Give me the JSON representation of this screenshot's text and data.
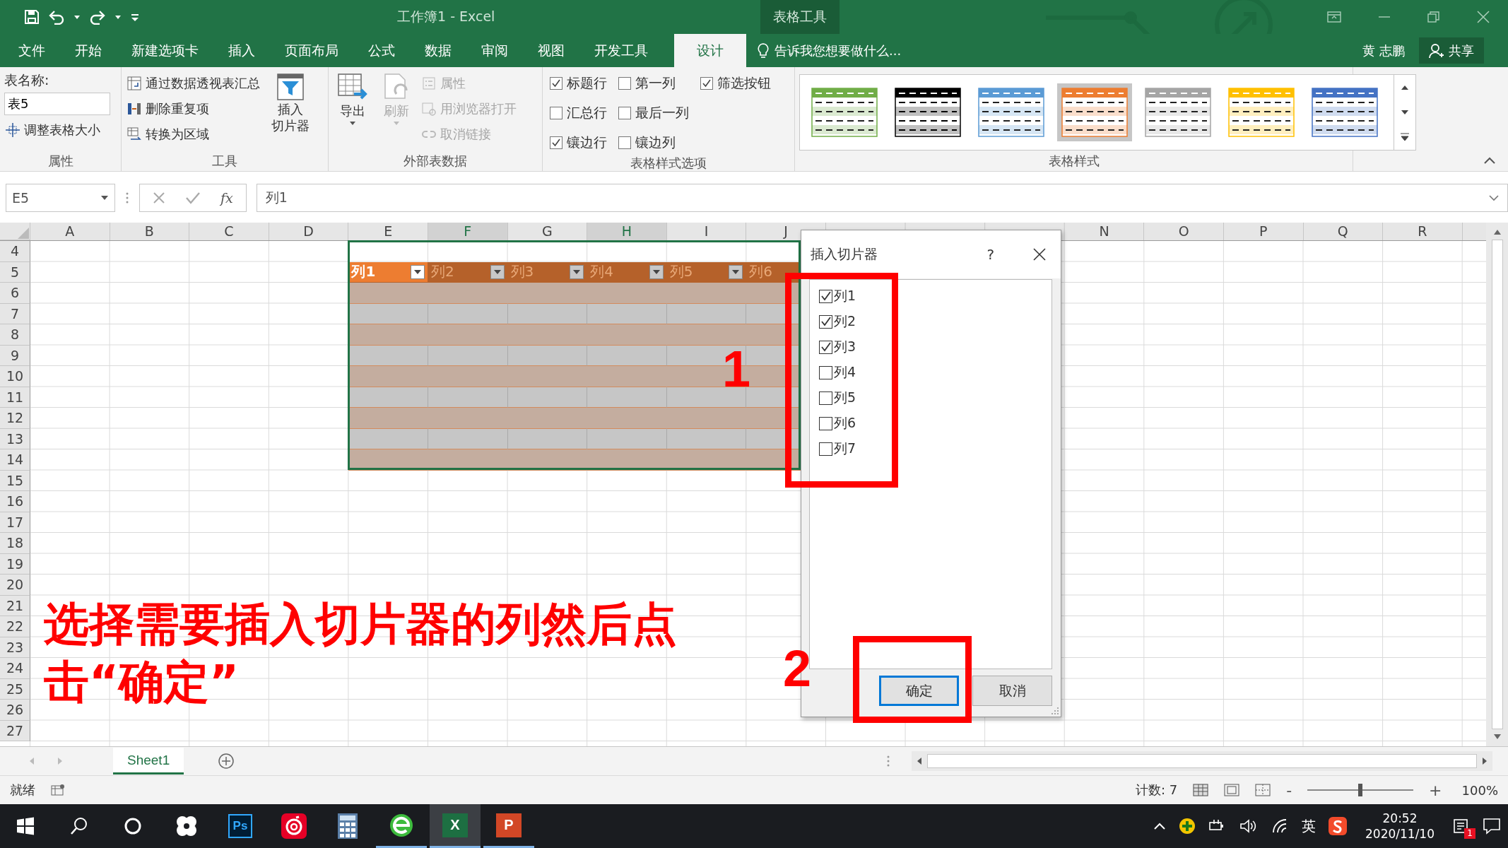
{
  "title_bar": {
    "title": "工作簿1 - Excel",
    "context_label": "表格工具"
  },
  "ribbon_tabs": [
    {
      "label": "文件",
      "selected": false
    },
    {
      "label": "开始",
      "selected": false
    },
    {
      "label": "新建选项卡",
      "selected": false
    },
    {
      "label": "插入",
      "selected": false
    },
    {
      "label": "页面布局",
      "selected": false
    },
    {
      "label": "公式",
      "selected": false
    },
    {
      "label": "数据",
      "selected": false
    },
    {
      "label": "审阅",
      "selected": false
    },
    {
      "label": "视图",
      "selected": false
    },
    {
      "label": "开发工具",
      "selected": false
    },
    {
      "label": "设计",
      "selected": true
    }
  ],
  "tell_me": {
    "placeholder": "告诉我您想要做什么..."
  },
  "user": {
    "name": "黄 志鹏"
  },
  "share_button": {
    "label": "共享"
  },
  "properties_group": {
    "label": "属性",
    "table_name_label": "表名称:",
    "table_name": "表5",
    "resize_button": "调整表格大小"
  },
  "tools_group": {
    "label": "工具",
    "buttons": [
      "通过数据透视表汇总",
      "删除重复项",
      "转换为区域"
    ],
    "slicer_button": [
      "插入",
      "切片器"
    ]
  },
  "external_group": {
    "label": "外部表数据",
    "export_button": "导出",
    "refresh_button": {
      "label": "刷新",
      "disabled": true
    },
    "buttons": [
      {
        "label": "属性",
        "disabled": true
      },
      {
        "label": "用浏览器打开",
        "disabled": true
      },
      {
        "label": "取消链接",
        "disabled": true
      }
    ]
  },
  "style_options_group": {
    "label": "表格样式选项",
    "options": [
      {
        "label": "标题行",
        "checked": true
      },
      {
        "label": "汇总行",
        "checked": false
      },
      {
        "label": "镶边行",
        "checked": true
      },
      {
        "label": "第一列",
        "checked": false
      },
      {
        "label": "最后一列",
        "checked": false
      },
      {
        "label": "镶边列",
        "checked": false
      },
      {
        "label": "筛选按钮",
        "checked": true
      }
    ]
  },
  "table_styles_group": {
    "label": "表格样式",
    "styles": [
      {
        "color": "#70ad47",
        "selected": false
      },
      {
        "color": "#000000",
        "selected": false
      },
      {
        "color": "#5b9bd5",
        "selected": false
      },
      {
        "color": "#ed7d31",
        "selected": true
      },
      {
        "color": "#a5a5a5",
        "selected": false
      },
      {
        "color": "#ffc000",
        "selected": false
      },
      {
        "color": "#4472c4",
        "selected": false
      }
    ]
  },
  "formula_bar": {
    "name_box": "E5",
    "function_label": "fx",
    "value": "列1"
  },
  "sheet": {
    "columns_left": [
      {
        "label": "A",
        "highlighted": false
      },
      {
        "label": "B",
        "highlighted": false
      },
      {
        "label": "C",
        "highlighted": false
      },
      {
        "label": "D",
        "highlighted": false
      },
      {
        "label": "E",
        "highlighted": false
      },
      {
        "label": "F",
        "highlighted": true
      },
      {
        "label": "G",
        "highlighted": false
      },
      {
        "label": "H",
        "highlighted": true
      },
      {
        "label": "I",
        "highlighted": false
      },
      {
        "label": "J",
        "highlighted": false
      }
    ],
    "columns_right": [
      {
        "label": "N",
        "highlighted": false
      },
      {
        "label": "O",
        "highlighted": false
      },
      {
        "label": "P",
        "highlighted": false
      },
      {
        "label": "Q",
        "highlighted": false
      },
      {
        "label": "R",
        "highlighted": false
      }
    ],
    "rows": [
      "4",
      "5",
      "6",
      "7",
      "8",
      "9",
      "10",
      "11",
      "12",
      "13",
      "14",
      "15",
      "16",
      "17",
      "18",
      "19",
      "20",
      "21",
      "22",
      "23",
      "24",
      "25",
      "26",
      "27"
    ],
    "table_headers": [
      {
        "label": "列1",
        "selected": true
      },
      {
        "label": "列2",
        "selected": false
      },
      {
        "label": "列3",
        "selected": false
      },
      {
        "label": "列4",
        "selected": false
      },
      {
        "label": "列5",
        "selected": false
      },
      {
        "label": "列6",
        "selected": false
      }
    ]
  },
  "dialog": {
    "title": "插入切片器",
    "help": "?",
    "fields": [
      {
        "label": "列1",
        "checked": true
      },
      {
        "label": "列2",
        "checked": true
      },
      {
        "label": "列3",
        "checked": true
      },
      {
        "label": "列4",
        "checked": false
      },
      {
        "label": "列5",
        "checked": false
      },
      {
        "label": "列6",
        "checked": false
      },
      {
        "label": "列7",
        "checked": false
      }
    ],
    "buttons": [
      {
        "label": "确定",
        "focused": true
      },
      {
        "label": "取消",
        "focused": false
      }
    ]
  },
  "annotations": {
    "step_numbers": [
      "1",
      "2"
    ],
    "instruction": "选择需要插入切片器的列然后点击“确定”"
  },
  "sheet_tabs": [
    {
      "label": "Sheet1",
      "selected": true
    }
  ],
  "status_bar": {
    "ready": "就绪",
    "count": "计数: 7",
    "zoom_out": "-",
    "zoom_slider": {
      "level": 0.5
    },
    "zoom_in": "+",
    "zoom": "100%"
  },
  "taskbar": {
    "apps": [
      {
        "kind": "start",
        "running": false,
        "selected": false
      },
      {
        "kind": "search",
        "running": false,
        "selected": false
      },
      {
        "kind": "cortana",
        "running": false,
        "selected": false
      },
      {
        "kind": "pinwheel",
        "running": false,
        "selected": false
      },
      {
        "kind": "photoshop",
        "label": "Ps",
        "running": false,
        "selected": false
      },
      {
        "kind": "music",
        "running": false,
        "selected": false
      },
      {
        "kind": "calculator",
        "running": false,
        "selected": false
      },
      {
        "kind": "browser",
        "running": true,
        "selected": false
      },
      {
        "kind": "excel",
        "label": "X",
        "running": true,
        "selected": true
      },
      {
        "kind": "powerpoint",
        "label": "P",
        "running": true,
        "selected": false
      }
    ],
    "ime": "英",
    "time": "20:52",
    "date": "2020/11/10",
    "notification_count": "1"
  }
}
